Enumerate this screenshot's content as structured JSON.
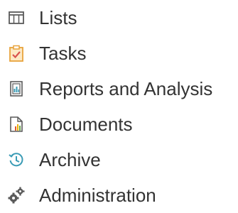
{
  "nav": {
    "items": [
      {
        "label": "Lists",
        "icon": "table-icon"
      },
      {
        "label": "Tasks",
        "icon": "clipboard-check-icon"
      },
      {
        "label": "Reports and Analysis",
        "icon": "report-icon"
      },
      {
        "label": "Documents",
        "icon": "document-chart-icon"
      },
      {
        "label": "Archive",
        "icon": "history-clock-icon"
      },
      {
        "label": "Administration",
        "icon": "gears-icon"
      }
    ]
  },
  "colors": {
    "text": "#333333",
    "icon_gray": "#5a5a5a",
    "task_orange": "#e8a33c",
    "task_red": "#d9534f",
    "archive_teal": "#3a9bb5",
    "bar_red": "#e05a2b",
    "bar_yellow": "#f0b400",
    "bar_green": "#6aa84f"
  }
}
